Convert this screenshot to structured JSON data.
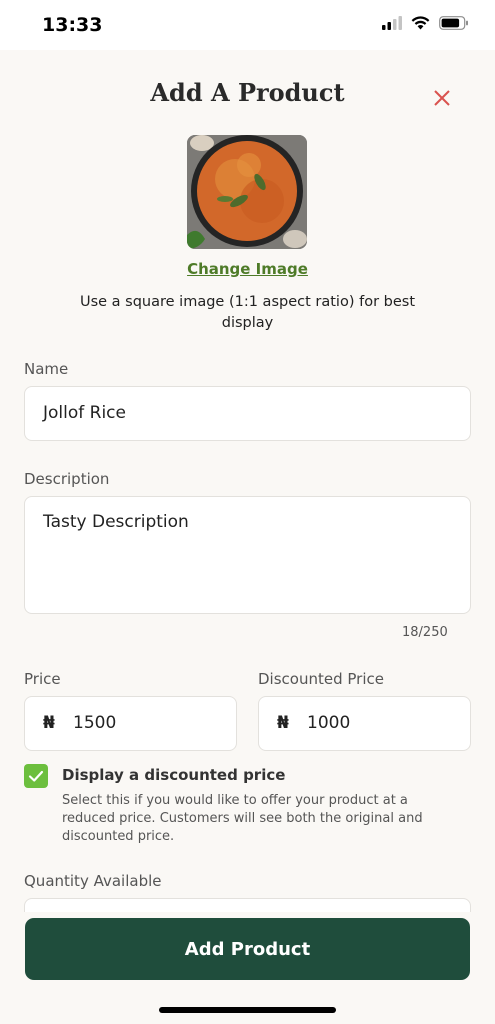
{
  "status_bar": {
    "time": "13:33"
  },
  "header": {
    "title": "Add A Product"
  },
  "image_section": {
    "change_label": "Change Image",
    "hint": "Use a square image (1:1 aspect ratio) for best display"
  },
  "form": {
    "name": {
      "label": "Name",
      "value": "Jollof Rice"
    },
    "description": {
      "label": "Description",
      "value": "Tasty Description",
      "counter": "18/250"
    },
    "price": {
      "label": "Price",
      "currency": "₦",
      "value": "1500"
    },
    "discounted_price": {
      "label": "Discounted Price",
      "currency": "₦",
      "value": "1000"
    },
    "discount_checkbox": {
      "checked": true,
      "label": "Display a discounted price",
      "help": "Select this if you would like to offer your product at a reduced price. Customers will see both the original and discounted price."
    },
    "quantity": {
      "label": "Quantity Available"
    }
  },
  "footer": {
    "submit_label": "Add Product"
  },
  "colors": {
    "primary": "#1f4d3c",
    "accent_green": "#6cbf3e",
    "link_green": "#4e7b28",
    "close_red": "#d9534f"
  }
}
